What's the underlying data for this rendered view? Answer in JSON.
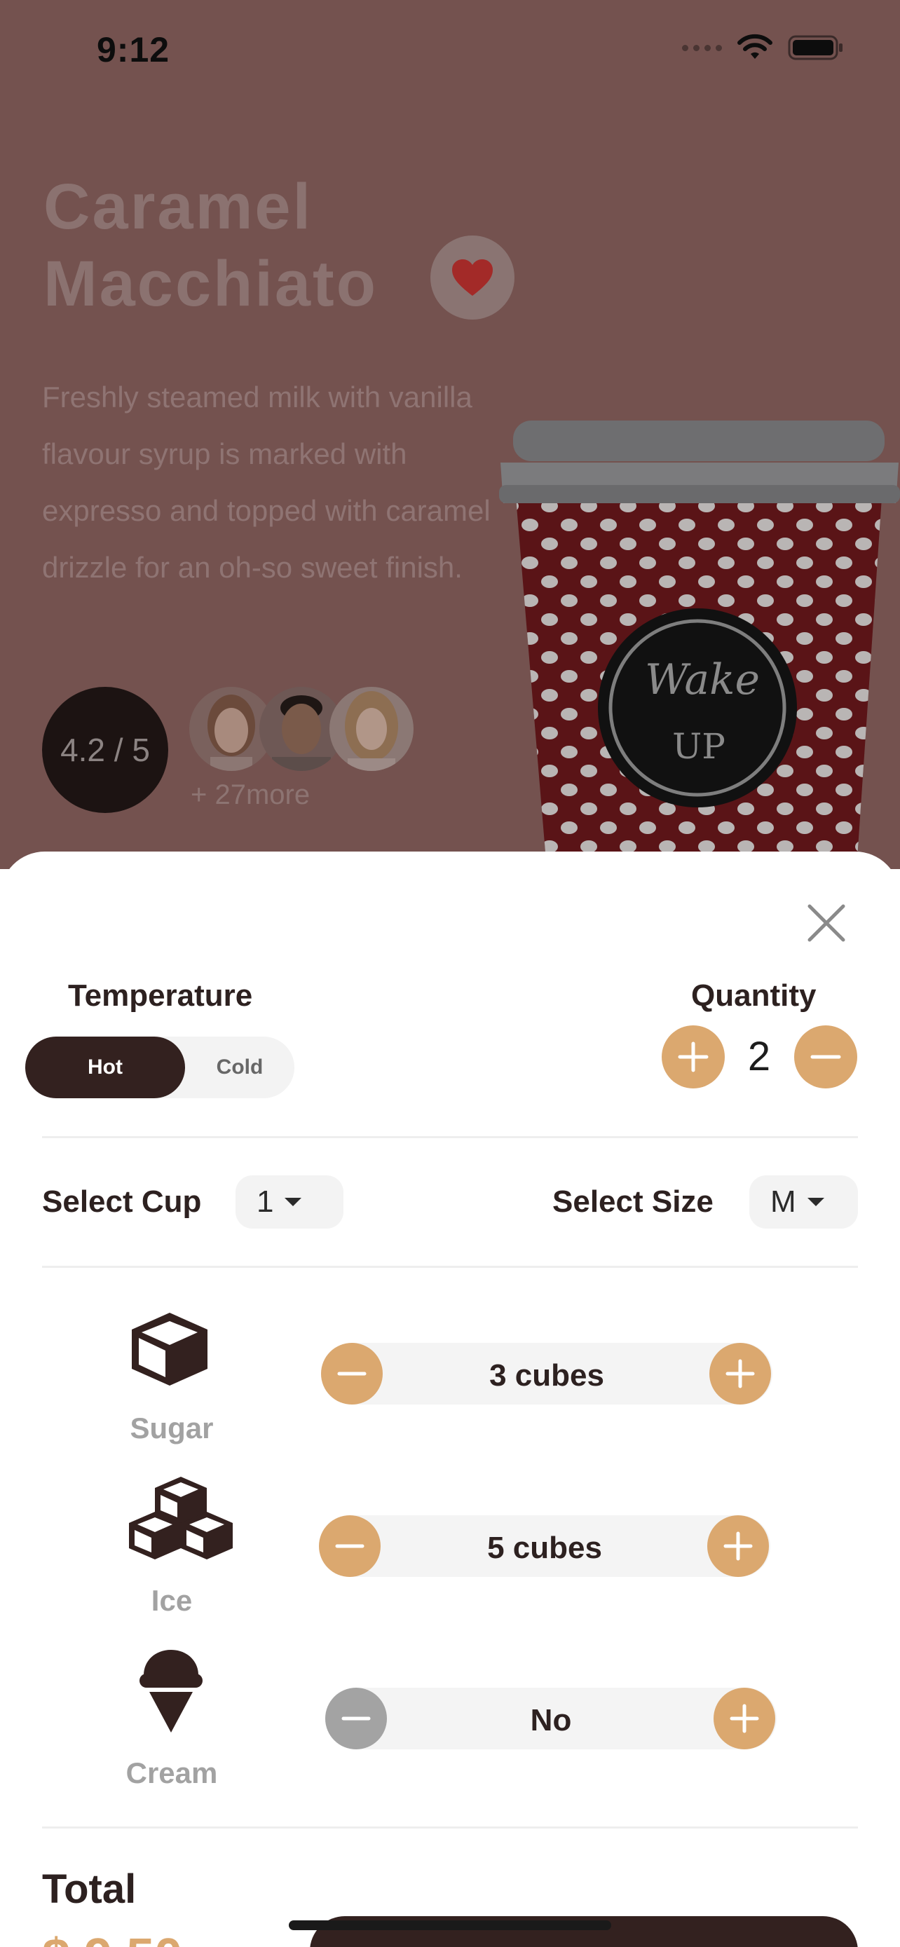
{
  "status_bar": {
    "time": "9:12"
  },
  "product": {
    "title_line1": "Caramel",
    "title_line2": "Macchiato",
    "description": "Freshly steamed milk with vanilla flavour syrup is marked with expresso and topped with caramel drizzle for an oh-so sweet finish.",
    "rating": "4.2 / 5",
    "reviewers_more": "+ 27more",
    "cup_logo_line1": "Wake",
    "cup_logo_line2": "UP"
  },
  "options": {
    "temperature_label": "Temperature",
    "temperature_options": [
      "Hot",
      "Cold"
    ],
    "temperature_selected": "Hot",
    "quantity_label": "Quantity",
    "quantity_value": "2",
    "select_cup_label": "Select Cup",
    "select_cup_value": "1",
    "select_size_label": "Select Size",
    "select_size_value": "M"
  },
  "addons": [
    {
      "name": "Sugar",
      "value": "3 cubes",
      "icon": "sugar-cube-icon"
    },
    {
      "name": "Ice",
      "value": "5 cubes",
      "icon": "ice-cubes-icon"
    },
    {
      "name": "Cream",
      "value": "No",
      "icon": "ice-cream-icon"
    }
  ],
  "total": {
    "label": "Total"
  },
  "colors": {
    "accent": "#dba86f",
    "dark": "#33211f",
    "overlay": "#74524f",
    "heart": "#a32a28"
  }
}
